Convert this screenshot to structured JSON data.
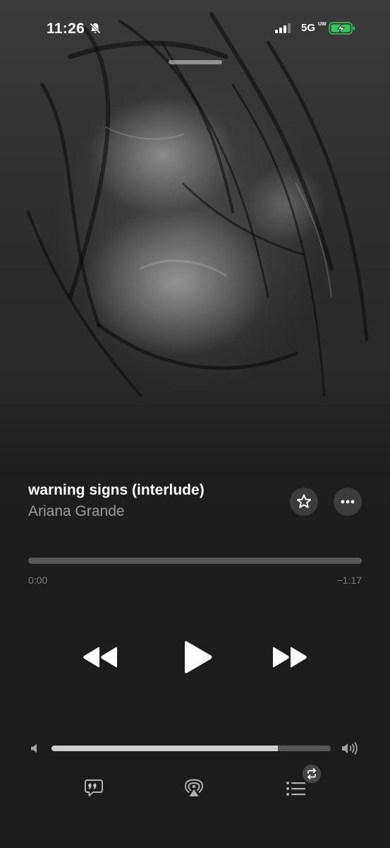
{
  "status_bar": {
    "time": "11:26",
    "network": "5G",
    "network_suffix": "UW",
    "silent_icon": "bell-slash-icon",
    "signal_icon": "cellular-signal-icon",
    "battery_icon": "battery-charging-icon",
    "battery_color": "#34c759"
  },
  "artwork": {
    "description_icon": "album-artwork"
  },
  "now_playing": {
    "title": "warning signs (interlude)",
    "artist": "Ariana Grande",
    "favorite_icon": "star-icon",
    "more_icon": "ellipsis-icon"
  },
  "progress": {
    "elapsed": "0:00",
    "remaining": "−1:17",
    "fraction": 0.0
  },
  "transport": {
    "rewind_icon": "rewind-icon",
    "play_icon": "play-icon",
    "forward_icon": "fast-forward-icon"
  },
  "volume": {
    "level": 0.81,
    "low_icon": "speaker-low-icon",
    "high_icon": "speaker-high-icon"
  },
  "bottom_bar": {
    "lyrics_icon": "lyrics-quote-bubble-icon",
    "airplay_icon": "airplay-audio-icon",
    "queue_icon": "queue-list-icon",
    "repeat_icon": "repeat-icon"
  }
}
